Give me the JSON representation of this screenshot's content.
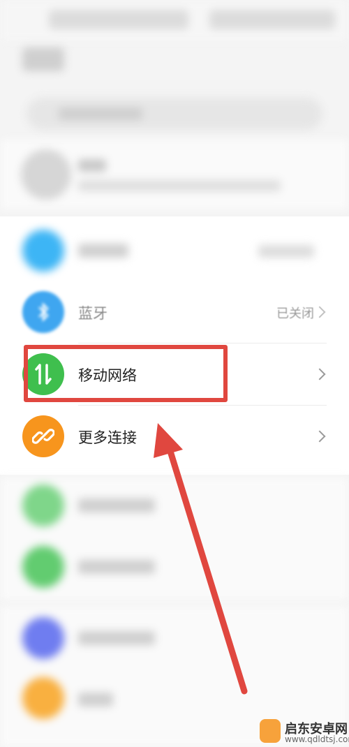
{
  "settings": {
    "rows": [
      {
        "label": "蓝牙",
        "value": "已关闭"
      },
      {
        "label": "移动网络"
      },
      {
        "label": "更多连接"
      }
    ]
  },
  "watermark": {
    "name": "启东安卓网",
    "url": "www.qdldtsj.com"
  },
  "colors": {
    "bluetooth": "#3fa6f0",
    "mobile_network": "#3fbf4e",
    "more_connections": "#f7951d",
    "highlight": "#e0473f"
  },
  "icons": {
    "bluetooth": "bluetooth-icon",
    "mobile_network": "mobile-data-arrows-icon",
    "more_connections": "link-icon",
    "chevron": "chevron-right-icon"
  }
}
